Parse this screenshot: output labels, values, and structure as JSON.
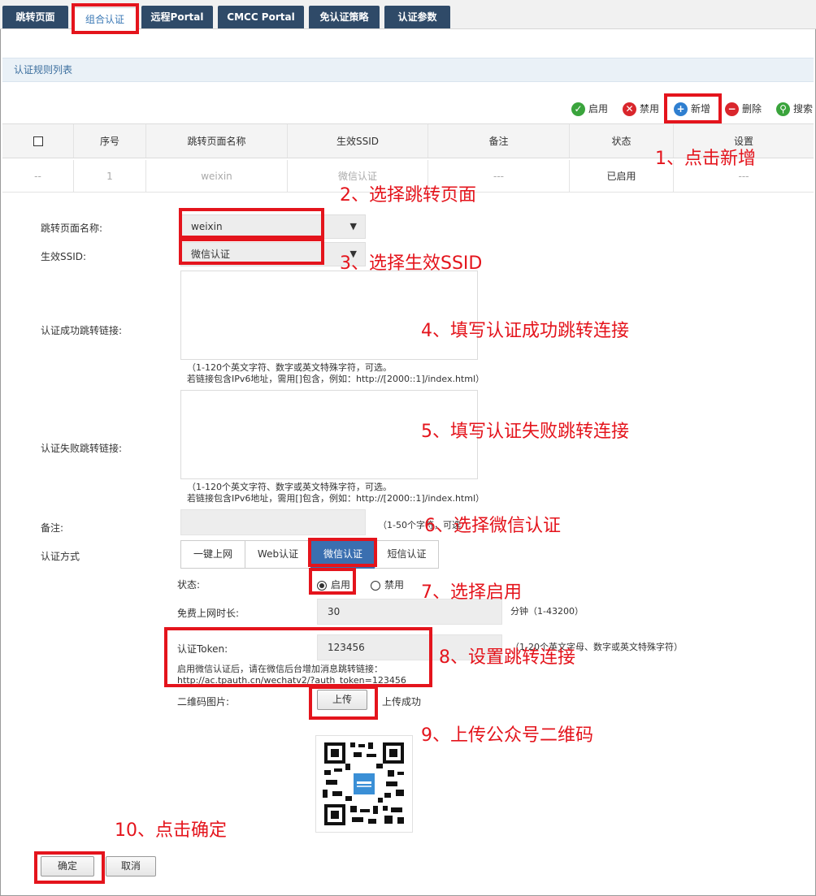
{
  "tabs": [
    {
      "label": "跳转页面"
    },
    {
      "label": "组合认证"
    },
    {
      "label": "远程Portal"
    },
    {
      "label": "CMCC Portal"
    },
    {
      "label": "免认证策略"
    },
    {
      "label": "认证参数"
    }
  ],
  "section_title": "认证规则列表",
  "toolbar": {
    "enable": "启用",
    "disable": "禁用",
    "add": "新增",
    "delete": "删除",
    "search": "搜索"
  },
  "table": {
    "headers": [
      "序号",
      "跳转页面名称",
      "生效SSID",
      "备注",
      "状态",
      "设置"
    ],
    "row": {
      "check": "--",
      "index": "1",
      "name": "weixin",
      "ssid": "微信认证",
      "note": "---",
      "status": "已启用",
      "settings": "---"
    }
  },
  "form": {
    "page_name_label": "跳转页面名称:",
    "page_name_value": "weixin",
    "ssid_label": "生效SSID:",
    "ssid_value": "微信认证",
    "success_link_label": "认证成功跳转链接:",
    "success_hint_1": "（1-120个英文字符、数字或英文特殊字符，可选。",
    "success_hint_2": "若链接包含IPv6地址，需用[]包含，例如：http://[2000::1]/index.html）",
    "fail_link_label": "认证失败跳转链接:",
    "fail_hint_1": "（1-120个英文字符、数字或英文特殊字符，可选。",
    "fail_hint_2": "若链接包含IPv6地址，需用[]包含，例如：http://[2000::1]/index.html）",
    "note_label": "备注:",
    "note_hint": "（1-50个字符，可选",
    "auth_method_label": "认证方式",
    "auth_methods": [
      "一键上网",
      "Web认证",
      "微信认证",
      "短信认证"
    ],
    "status_label": "状态:",
    "status_on": "启用",
    "status_off": "禁用",
    "free_time_label": "免费上网时长:",
    "free_time_value": "30",
    "free_time_hint": "分钟（1-43200）",
    "token_label": "认证Token:",
    "token_value": "123456",
    "token_hint": "（1-20个英文字母、数字或英文特殊字符）",
    "token_note_1": "启用微信认证后，请在微信后台增加消息跳转链接：",
    "token_note_2": "http://ac.tpauth.cn/wechatv2/?auth_token=123456",
    "qr_label": "二维码图片:",
    "upload_button": "上传",
    "upload_status": "上传成功",
    "ok_button": "确定",
    "cancel_button": "取消"
  },
  "annotations": {
    "a1": "1、点击新增",
    "a2": "2、选择跳转页面",
    "a3": "3、选择生效SSID",
    "a4": "4、填写认证成功跳转连接",
    "a5": "5、填写认证失败跳转连接",
    "a6": "6、选择微信认证",
    "a7": "7、选择启用",
    "a8": "8、设置跳转连接",
    "a9": "9、上传公众号二维码",
    "a10": "10、点击确定"
  },
  "colors": {
    "annotation": "#e4141c",
    "tab_bg": "#2f4a68",
    "active_segment": "#3a6fb0"
  }
}
